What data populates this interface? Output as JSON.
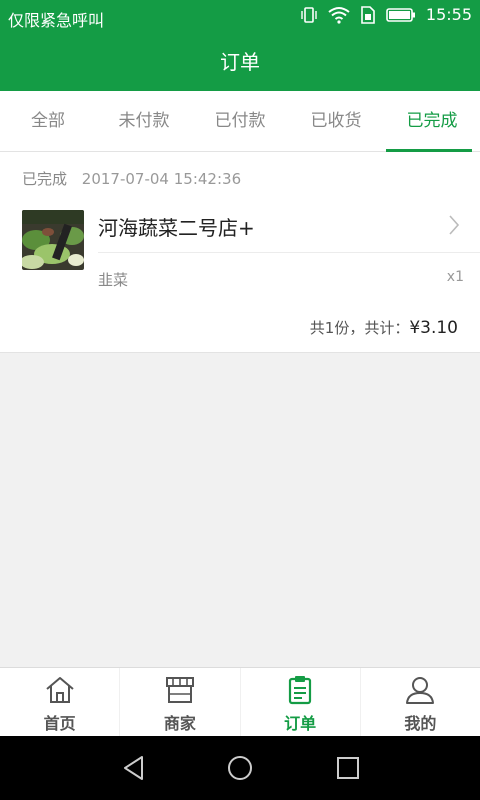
{
  "status_bar": {
    "carrier": "仅限紧急呼叫",
    "time": "15:55"
  },
  "header": {
    "title": "订单"
  },
  "tabs": [
    {
      "label": "全部"
    },
    {
      "label": "未付款"
    },
    {
      "label": "已付款"
    },
    {
      "label": "已收货"
    },
    {
      "label": "已完成"
    }
  ],
  "active_tab": "已完成",
  "order": {
    "status": "已完成",
    "datetime": "2017-07-04 15:42:36",
    "shop_name": "河海蔬菜二号店+",
    "item_name": "韭菜",
    "item_qty": "x1",
    "summary_prefix": "共1份，共计：",
    "total": "¥3.10"
  },
  "bottom_nav": [
    {
      "label": "首页",
      "icon": "home-icon"
    },
    {
      "label": "商家",
      "icon": "store-icon"
    },
    {
      "label": "订单",
      "icon": "order-icon"
    },
    {
      "label": "我的",
      "icon": "user-icon"
    }
  ],
  "colors": {
    "brand": "#149c45",
    "background": "#f1f1f1"
  }
}
